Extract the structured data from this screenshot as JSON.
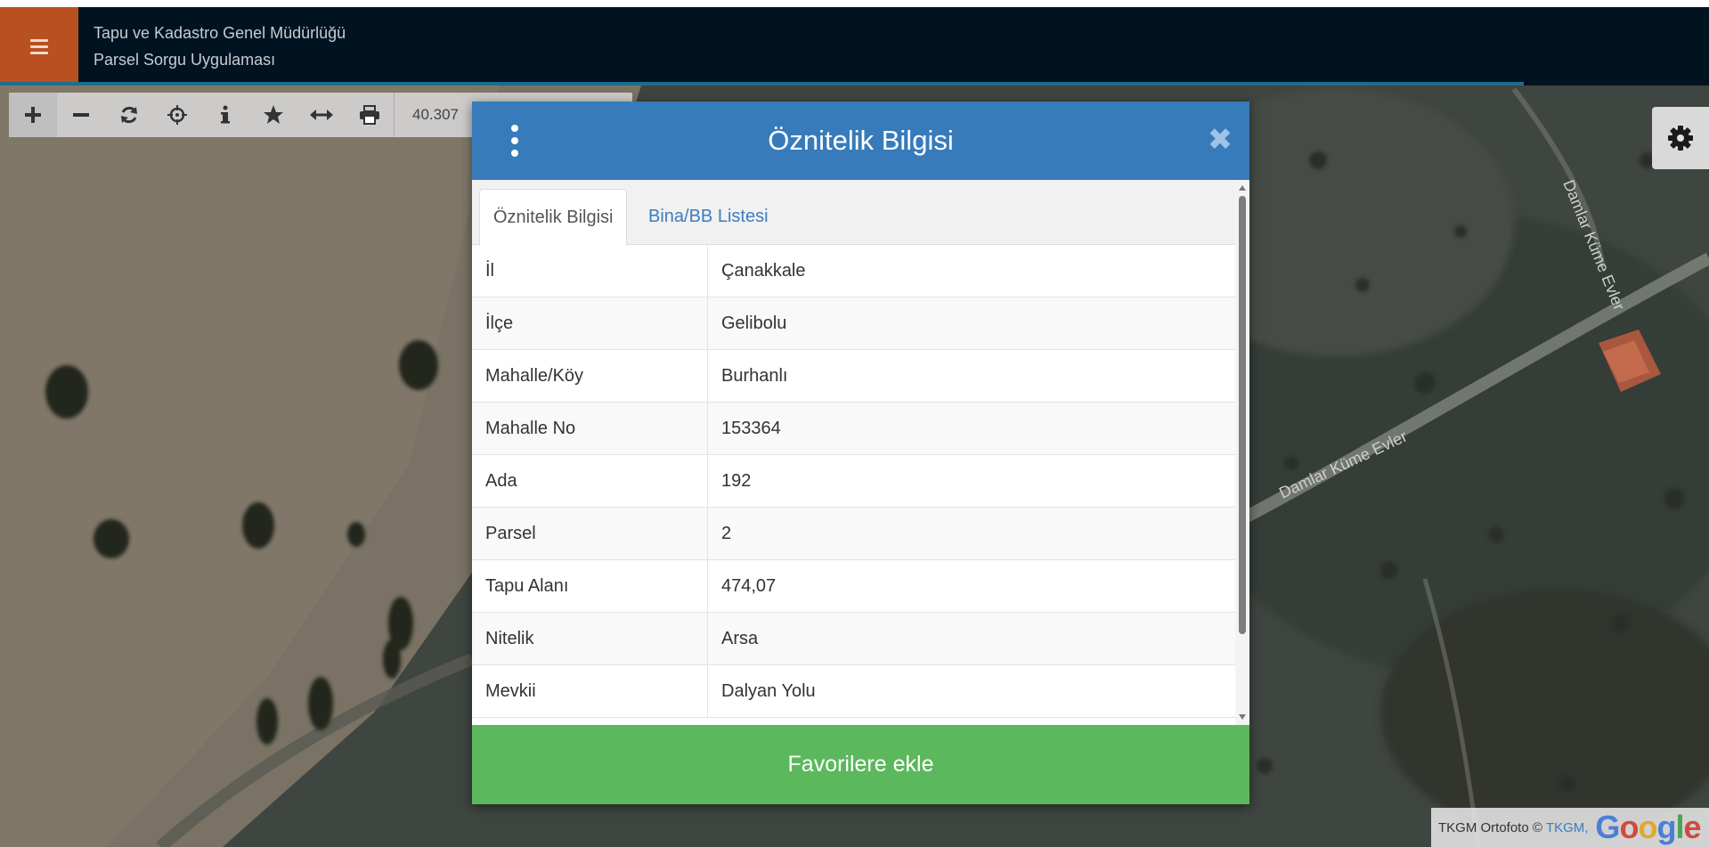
{
  "header": {
    "title_line1": "Tapu ve Kadastro Genel Müdürlüğü",
    "title_line2": "Parsel Sorgu Uygulaması"
  },
  "toolbar": {
    "coordinate": "40.307"
  },
  "map_labels": {
    "road_label_1": "Damlar Küme Evler",
    "road_label_2": "Damlar Küme Evler"
  },
  "modal": {
    "title": "Öznitelik Bilgisi",
    "tabs": [
      {
        "label": "Öznitelik Bilgisi"
      },
      {
        "label": "Bina/BB Listesi"
      }
    ],
    "rows": [
      {
        "key": "İl",
        "value": "Çanakkale"
      },
      {
        "key": "İlçe",
        "value": "Gelibolu"
      },
      {
        "key": "Mahalle/Köy",
        "value": "Burhanlı"
      },
      {
        "key": "Mahalle No",
        "value": "153364"
      },
      {
        "key": "Ada",
        "value": "192"
      },
      {
        "key": "Parsel",
        "value": "2"
      },
      {
        "key": "Tapu Alanı",
        "value": "474,07"
      },
      {
        "key": "Nitelik",
        "value": "Arsa"
      },
      {
        "key": "Mevkii",
        "value": "Dalyan Yolu"
      }
    ],
    "favorite_button": "Favorilere ekle"
  },
  "attribution": {
    "text": "TKGM Ortofoto ©",
    "link": "TKGM,",
    "google": "Google"
  },
  "colors": {
    "header_bg": "#011321",
    "menu_button": "#b9501f",
    "modal_header": "#377bbb",
    "favorite_button": "#5cb85c",
    "tab_link": "#3c7dc0"
  }
}
